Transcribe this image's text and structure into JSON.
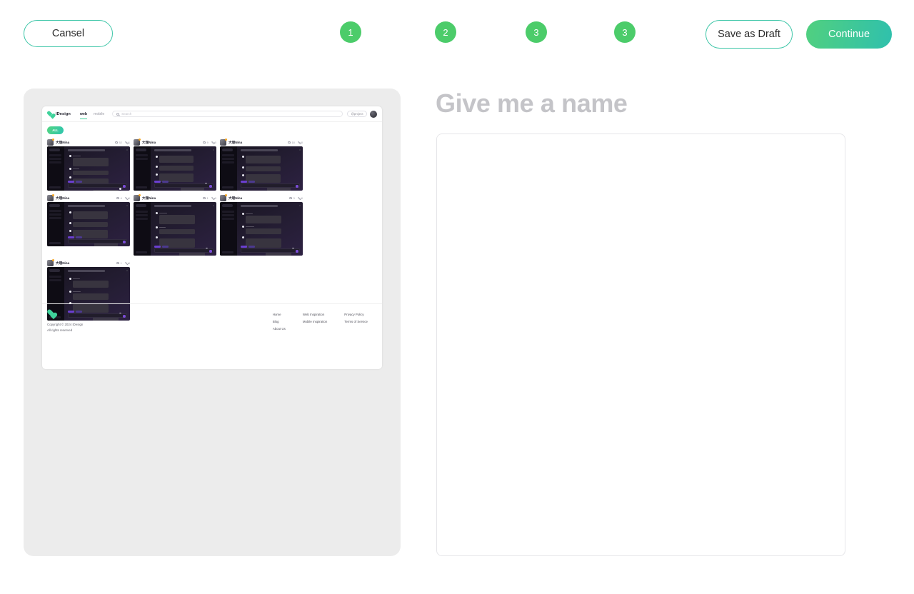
{
  "topbar": {
    "cancel_label": "Cansel",
    "save_draft_label": "Save as Draft",
    "continue_label": "Continue",
    "accent_color": "#3ec6a8",
    "continue_gradient_from": "#51d07f",
    "continue_gradient_to": "#2fc0ad",
    "step_color": "#4ccc6a",
    "steps": [
      {
        "label": "1"
      },
      {
        "label": "2"
      },
      {
        "label": "3"
      },
      {
        "label": "3"
      }
    ]
  },
  "right_panel": {
    "name_placeholder": "Give me a name",
    "description_value": "",
    "description_placeholder": ""
  },
  "preview": {
    "nav": {
      "brand": "IDesign",
      "links": [
        {
          "label": "web",
          "active": true
        },
        {
          "label": "mobile",
          "active": false
        }
      ],
      "search_placeholder": "Search",
      "project_label": "@project"
    },
    "filters": [
      {
        "label": "ALL",
        "active": true
      }
    ],
    "cards": [
      {
        "user": "大理Nina",
        "views": "52",
        "likes": "1"
      },
      {
        "user": "大理Nina",
        "views": "9",
        "likes": "0"
      },
      {
        "user": "大理Nina",
        "views": "18",
        "likes": "0"
      },
      {
        "user": "大理Nina",
        "views": "4",
        "likes": "0"
      },
      {
        "user": "大理Nina",
        "views": "1",
        "likes": "0"
      },
      {
        "user": "大理Nina",
        "views": "3",
        "likes": "0"
      },
      {
        "user": "大理Nina",
        "views": "1",
        "likes": "0"
      }
    ],
    "footer": {
      "copyright": "Copyright © 2024 IDesign",
      "rights": "All rights reserved",
      "columns": [
        {
          "links": [
            "Home",
            "Blog",
            "About Us"
          ]
        },
        {
          "links": [
            "Web Inspiration",
            "Mobile Inspiration"
          ]
        },
        {
          "links": [
            "Privacy Policy",
            "Terms of Service"
          ]
        }
      ]
    }
  }
}
